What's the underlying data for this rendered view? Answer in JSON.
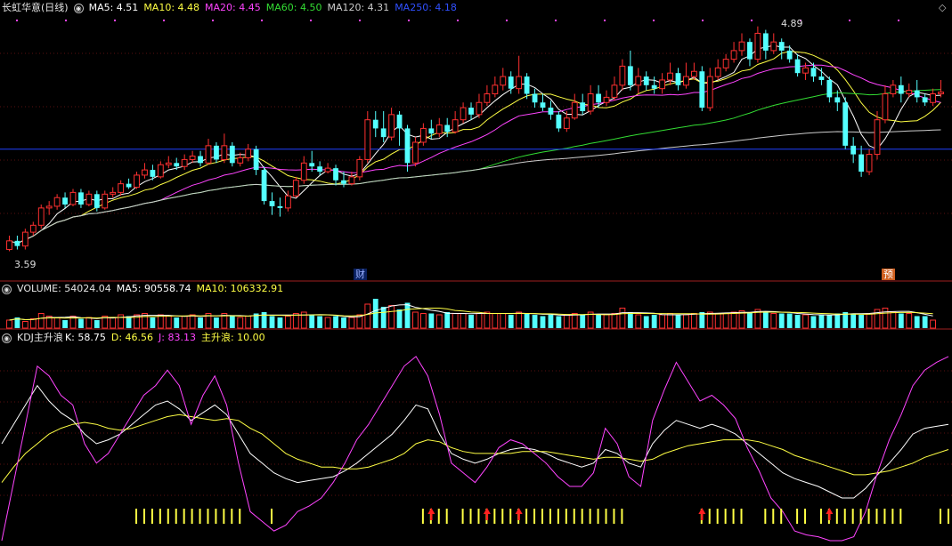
{
  "main_header": {
    "title": "长虹华意(日线)",
    "ma5": "MA5: 4.51",
    "ma10": "MA10: 4.48",
    "ma20": "MA20: 4.45",
    "ma60": "MA60: 4.50",
    "ma120": "MA120: 4.31",
    "ma250": "MA250: 4.18",
    "hi_label": "4.89",
    "lo_label": "3.59",
    "marker_cai": "财",
    "marker_yu": "预"
  },
  "volume_header": {
    "title": "VOLUME: 54024.04",
    "ma5": "MA5: 90558.74",
    "ma10": "MA10: 106332.91"
  },
  "kdj_header": {
    "title": "KDJ主升浪",
    "k": "K: 58.75",
    "d": "D: 46.56",
    "j": "J: 83.13",
    "zsl": "主升浪: 10.00"
  },
  "colors": {
    "up": "#ff3030",
    "down": "#54ffff",
    "ma5": "#ffffff",
    "ma10": "#ffff44",
    "ma20": "#ff44ff",
    "ma60": "#33dd33",
    "ma120": "#cccccc",
    "ma250": "#2040ff",
    "k": "#ffffff",
    "d": "#ffff44",
    "j": "#ff44ff",
    "zsl": "#ffff44",
    "arrow": "#ff2020"
  },
  "chart_data": {
    "type": "candlestick",
    "price_range": [
      3.5,
      4.95
    ],
    "ma250_level": 4.18,
    "candles": [
      [
        3.6,
        3.65,
        3.68,
        3.59
      ],
      [
        3.65,
        3.62,
        3.68,
        3.6
      ],
      [
        3.62,
        3.7,
        3.72,
        3.6
      ],
      [
        3.7,
        3.74,
        3.76,
        3.68
      ],
      [
        3.74,
        3.84,
        3.86,
        3.72
      ],
      [
        3.84,
        3.85,
        3.88,
        3.8
      ],
      [
        3.85,
        3.9,
        3.92,
        3.83
      ],
      [
        3.9,
        3.86,
        3.93,
        3.84
      ],
      [
        3.86,
        3.93,
        3.95,
        3.85
      ],
      [
        3.93,
        3.86,
        3.95,
        3.84
      ],
      [
        3.86,
        3.92,
        3.94,
        3.85
      ],
      [
        3.92,
        3.84,
        3.94,
        3.82
      ],
      [
        3.84,
        3.92,
        3.94,
        3.83
      ],
      [
        3.92,
        3.93,
        3.96,
        3.9
      ],
      [
        3.93,
        3.98,
        4.0,
        3.91
      ],
      [
        3.98,
        3.96,
        4.01,
        3.95
      ],
      [
        3.96,
        4.03,
        4.05,
        3.95
      ],
      [
        4.03,
        4.06,
        4.1,
        4.01
      ],
      [
        4.06,
        4.02,
        4.09,
        4.0
      ],
      [
        4.02,
        4.09,
        4.11,
        4.01
      ],
      [
        4.09,
        4.1,
        4.14,
        4.07
      ],
      [
        4.1,
        4.08,
        4.13,
        4.06
      ],
      [
        4.08,
        4.12,
        4.15,
        4.06
      ],
      [
        4.12,
        4.14,
        4.17,
        4.1
      ],
      [
        4.14,
        4.1,
        4.17,
        4.08
      ],
      [
        4.1,
        4.2,
        4.24,
        4.09
      ],
      [
        4.2,
        4.12,
        4.22,
        4.1
      ],
      [
        4.12,
        4.2,
        4.27,
        4.1
      ],
      [
        4.2,
        4.1,
        4.22,
        4.08
      ],
      [
        4.1,
        4.13,
        4.16,
        4.08
      ],
      [
        4.13,
        4.18,
        4.21,
        4.11
      ],
      [
        4.18,
        4.06,
        4.2,
        4.03
      ],
      [
        4.06,
        3.88,
        4.08,
        3.86
      ],
      [
        3.88,
        3.85,
        3.93,
        3.8
      ],
      [
        3.85,
        3.84,
        3.9,
        3.79
      ],
      [
        3.84,
        3.91,
        3.94,
        3.82
      ],
      [
        3.91,
        4.0,
        4.02,
        3.9
      ],
      [
        4.0,
        4.1,
        4.14,
        3.98
      ],
      [
        4.1,
        4.08,
        4.17,
        4.05
      ],
      [
        4.08,
        4.05,
        4.11,
        4.03
      ],
      [
        4.05,
        4.07,
        4.1,
        4.04
      ],
      [
        4.07,
        4.0,
        4.09,
        3.97
      ],
      [
        4.0,
        3.98,
        4.05,
        3.96
      ],
      [
        3.98,
        4.02,
        4.05,
        3.97
      ],
      [
        4.02,
        4.12,
        4.14,
        4.0
      ],
      [
        4.12,
        4.35,
        4.4,
        4.1
      ],
      [
        4.35,
        4.3,
        4.4,
        4.25
      ],
      [
        4.3,
        4.25,
        4.4,
        4.22
      ],
      [
        4.25,
        4.38,
        4.42,
        4.23
      ],
      [
        4.38,
        4.3,
        4.4,
        4.2
      ],
      [
        4.3,
        4.1,
        4.32,
        4.05
      ],
      [
        4.1,
        4.22,
        4.25,
        4.08
      ],
      [
        4.22,
        4.3,
        4.33,
        4.2
      ],
      [
        4.3,
        4.27,
        4.35,
        4.24
      ],
      [
        4.27,
        4.32,
        4.36,
        4.25
      ],
      [
        4.32,
        4.28,
        4.36,
        4.25
      ],
      [
        4.28,
        4.35,
        4.4,
        4.27
      ],
      [
        4.35,
        4.42,
        4.45,
        4.33
      ],
      [
        4.42,
        4.38,
        4.45,
        4.35
      ],
      [
        4.38,
        4.45,
        4.5,
        4.36
      ],
      [
        4.45,
        4.5,
        4.55,
        4.43
      ],
      [
        4.5,
        4.55,
        4.6,
        4.48
      ],
      [
        4.55,
        4.6,
        4.65,
        4.52
      ],
      [
        4.6,
        4.53,
        4.63,
        4.5
      ],
      [
        4.53,
        4.6,
        4.72,
        4.5
      ],
      [
        4.6,
        4.5,
        4.62,
        4.47
      ],
      [
        4.5,
        4.45,
        4.53,
        4.42
      ],
      [
        4.45,
        4.42,
        4.5,
        4.4
      ],
      [
        4.42,
        4.38,
        4.46,
        4.35
      ],
      [
        4.38,
        4.3,
        4.4,
        4.28
      ],
      [
        4.3,
        4.36,
        4.4,
        4.28
      ],
      [
        4.36,
        4.45,
        4.5,
        4.35
      ],
      [
        4.45,
        4.4,
        4.5,
        4.38
      ],
      [
        4.4,
        4.5,
        4.55,
        4.38
      ],
      [
        4.5,
        4.45,
        4.55,
        4.42
      ],
      [
        4.45,
        4.48,
        4.52,
        4.43
      ],
      [
        4.48,
        4.55,
        4.6,
        4.46
      ],
      [
        4.55,
        4.66,
        4.7,
        4.52
      ],
      [
        4.66,
        4.55,
        4.75,
        4.52
      ],
      [
        4.55,
        4.6,
        4.65,
        4.5
      ],
      [
        4.6,
        4.55,
        4.63,
        4.52
      ],
      [
        4.55,
        4.53,
        4.6,
        4.5
      ],
      [
        4.53,
        4.58,
        4.62,
        4.5
      ],
      [
        4.58,
        4.62,
        4.68,
        4.55
      ],
      [
        4.62,
        4.55,
        4.65,
        4.52
      ],
      [
        4.55,
        4.6,
        4.68,
        4.53
      ],
      [
        4.6,
        4.63,
        4.68,
        4.58
      ],
      [
        4.63,
        4.42,
        4.66,
        4.4
      ],
      [
        4.42,
        4.6,
        4.65,
        4.4
      ],
      [
        4.6,
        4.65,
        4.7,
        4.58
      ],
      [
        4.65,
        4.7,
        4.73,
        4.63
      ],
      [
        4.7,
        4.75,
        4.8,
        4.68
      ],
      [
        4.75,
        4.8,
        4.85,
        4.72
      ],
      [
        4.8,
        4.7,
        4.82,
        4.66
      ],
      [
        4.7,
        4.85,
        4.89,
        4.68
      ],
      [
        4.85,
        4.75,
        4.87,
        4.7
      ],
      [
        4.75,
        4.8,
        4.85,
        4.73
      ],
      [
        4.8,
        4.75,
        4.82,
        4.7
      ],
      [
        4.75,
        4.7,
        4.78,
        4.68
      ],
      [
        4.7,
        4.62,
        4.73,
        4.6
      ],
      [
        4.62,
        4.65,
        4.68,
        4.58
      ],
      [
        4.65,
        4.6,
        4.68,
        4.57
      ],
      [
        4.6,
        4.58,
        4.65,
        4.55
      ],
      [
        4.58,
        4.48,
        4.6,
        4.45
      ],
      [
        4.48,
        4.45,
        4.52,
        4.4
      ],
      [
        4.45,
        4.2,
        4.48,
        4.18
      ],
      [
        4.2,
        4.15,
        4.25,
        4.1
      ],
      [
        4.15,
        4.05,
        4.2,
        4.02
      ],
      [
        4.05,
        4.15,
        4.18,
        4.03
      ],
      [
        4.15,
        4.35,
        4.4,
        4.12
      ],
      [
        4.35,
        4.5,
        4.55,
        4.33
      ],
      [
        4.5,
        4.55,
        4.58,
        4.48
      ],
      [
        4.55,
        4.5,
        4.6,
        4.45
      ],
      [
        4.5,
        4.52,
        4.56,
        4.48
      ],
      [
        4.52,
        4.48,
        4.58,
        4.45
      ],
      [
        4.48,
        4.45,
        4.5,
        4.43
      ],
      [
        4.45,
        4.5,
        4.53,
        4.43
      ],
      [
        4.5,
        4.51,
        4.58,
        4.48
      ]
    ],
    "volume": [
      30,
      40,
      25,
      35,
      55,
      45,
      40,
      30,
      45,
      35,
      40,
      30,
      45,
      40,
      50,
      45,
      50,
      55,
      40,
      50,
      45,
      40,
      45,
      50,
      40,
      55,
      40,
      55,
      45,
      40,
      45,
      55,
      60,
      45,
      40,
      45,
      55,
      60,
      50,
      45,
      40,
      45,
      40,
      40,
      50,
      90,
      110,
      80,
      85,
      70,
      95,
      60,
      55,
      55,
      50,
      60,
      55,
      55,
      50,
      55,
      60,
      55,
      55,
      50,
      60,
      55,
      50,
      45,
      50,
      45,
      50,
      55,
      50,
      60,
      50,
      50,
      55,
      75,
      60,
      50,
      45,
      50,
      50,
      55,
      50,
      50,
      55,
      60,
      60,
      55,
      55,
      60,
      65,
      60,
      70,
      60,
      55,
      55,
      55,
      50,
      50,
      45,
      50,
      50,
      55,
      60,
      55,
      50,
      55,
      70,
      75,
      60,
      55,
      55,
      45,
      45,
      30
    ],
    "kdj": {
      "k": [
        50,
        60,
        70,
        80,
        72,
        66,
        62,
        55,
        50,
        52,
        55,
        60,
        65,
        70,
        72,
        68,
        62,
        66,
        70,
        65,
        55,
        45,
        40,
        35,
        32,
        30,
        31,
        32,
        33,
        36,
        40,
        45,
        50,
        55,
        62,
        70,
        68,
        55,
        45,
        42,
        40,
        42,
        45,
        47,
        48,
        47,
        45,
        42,
        40,
        38,
        40,
        47,
        45,
        40,
        38,
        50,
        57,
        62,
        60,
        58,
        60,
        58,
        55,
        50,
        45,
        40,
        35,
        32,
        30,
        28,
        25,
        22,
        22,
        27,
        34,
        40,
        47,
        55,
        58,
        59,
        60
      ],
      "d": [
        30,
        38,
        45,
        50,
        55,
        58,
        60,
        61,
        60,
        58,
        57,
        58,
        60,
        62,
        64,
        65,
        64,
        63,
        62,
        63,
        62,
        58,
        55,
        50,
        45,
        42,
        40,
        38,
        38,
        37,
        37,
        38,
        40,
        42,
        45,
        50,
        52,
        51,
        48,
        46,
        45,
        45,
        45,
        45,
        46,
        46,
        46,
        45,
        44,
        43,
        42,
        43,
        43,
        42,
        41,
        42,
        45,
        47,
        49,
        50,
        51,
        52,
        52,
        52,
        51,
        49,
        47,
        44,
        42,
        40,
        38,
        36,
        34,
        34,
        35,
        36,
        38,
        40,
        43,
        45,
        47
      ],
      "j": [
        0,
        30,
        60,
        90,
        85,
        75,
        70,
        50,
        40,
        45,
        55,
        65,
        75,
        80,
        88,
        80,
        60,
        75,
        85,
        70,
        40,
        15,
        10,
        5,
        8,
        15,
        18,
        22,
        30,
        40,
        52,
        60,
        70,
        80,
        90,
        95,
        85,
        65,
        40,
        35,
        30,
        38,
        48,
        52,
        50,
        45,
        40,
        33,
        28,
        28,
        35,
        58,
        50,
        33,
        28,
        62,
        78,
        92,
        82,
        72,
        75,
        70,
        63,
        48,
        36,
        22,
        15,
        5,
        3,
        2,
        0,
        0,
        2,
        15,
        35,
        52,
        65,
        80,
        88,
        92,
        95
      ],
      "zsl_bars": [
        16,
        17,
        18,
        19,
        20,
        21,
        22,
        23,
        24,
        25,
        26,
        27,
        28,
        29,
        33,
        52,
        53,
        54,
        55,
        57,
        58,
        59,
        60,
        61,
        62,
        63,
        64,
        65,
        66,
        67,
        68,
        69,
        70,
        71,
        72,
        73,
        74,
        75,
        76,
        77,
        87,
        88,
        89,
        90,
        91,
        92,
        95,
        96,
        97,
        99,
        100,
        102,
        103,
        104,
        105,
        106,
        107,
        108,
        109,
        110,
        111,
        112,
        117,
        118,
        121,
        122
      ],
      "arrows": [
        53,
        60,
        64,
        87,
        103,
        122
      ]
    }
  }
}
